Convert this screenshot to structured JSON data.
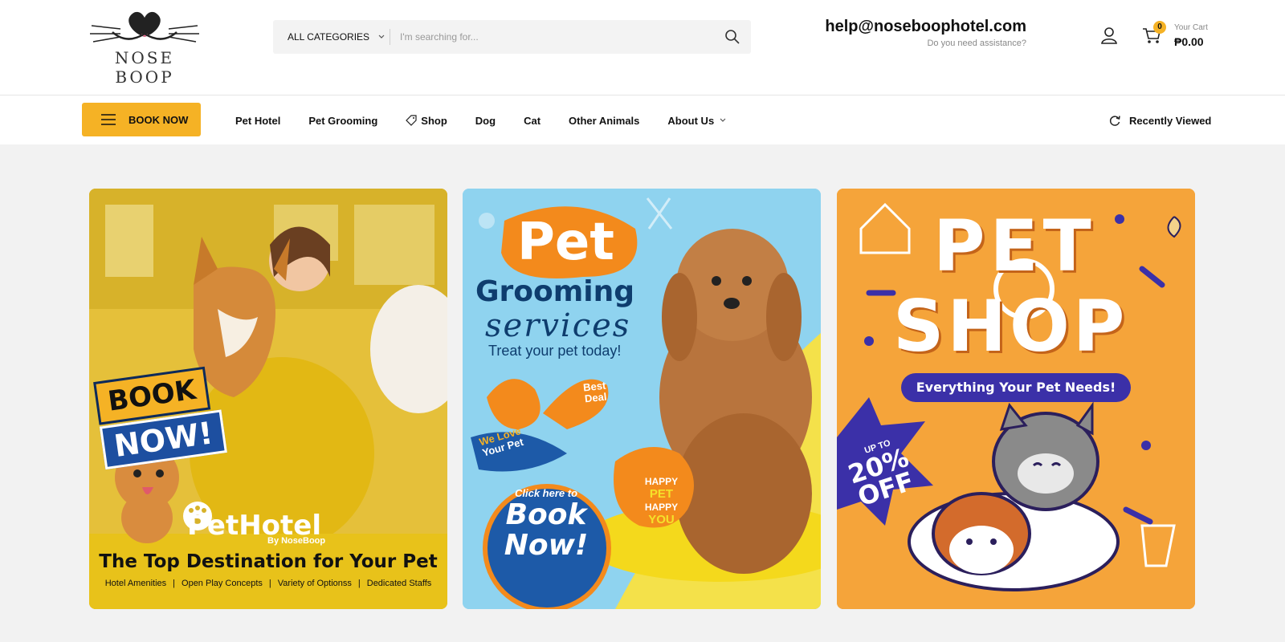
{
  "brand": {
    "logo_text": "NOSE BOOP"
  },
  "search": {
    "category": "ALL CATEGORIES",
    "placeholder": "I'm searching for..."
  },
  "contact": {
    "email": "help@noseboophotel.com",
    "subtitle": "Do you need assistance?"
  },
  "cart": {
    "count": "0",
    "label": "Your Cart",
    "total": "₱0.00"
  },
  "nav": {
    "book_now": "BOOK NOW",
    "links": [
      "Pet Hotel",
      "Pet Grooming",
      "Shop",
      "Dog",
      "Cat",
      "Other Animals",
      "About Us"
    ],
    "recently_viewed": "Recently Viewed"
  },
  "banners": {
    "hotel": {
      "stamp_line1": "BOOK",
      "stamp_line2": "NOW!",
      "brand": "PetHotel",
      "brand_sub": "By NoseBoop",
      "title": "The Top Destination for Your Pet",
      "features": [
        "Hotel Amenities",
        "Open Play Concepts",
        "Variety of Optionss",
        "Dedicated Staffs"
      ]
    },
    "grooming": {
      "line1": "Pet",
      "line2": "Grooming",
      "line3": "services",
      "tagline": "Treat your pet today!",
      "best_deal": "Best Deal",
      "we_love": "We Love",
      "your_pet": "Your Pet",
      "click_here": "Click here to",
      "book_now": "Book Now!",
      "happy1": "HAPPY",
      "pet": "PET",
      "happy2": "HAPPY",
      "you": "YOU"
    },
    "shop": {
      "line1": "PET",
      "line2": "SHOP",
      "tagline": "Everything Your Pet Needs!",
      "up_to": "UP TO",
      "discount": "20%",
      "off": "OFF"
    }
  },
  "colors": {
    "accent": "#f5b225",
    "navy": "#0e3d6e",
    "purple": "#3b30a8"
  }
}
